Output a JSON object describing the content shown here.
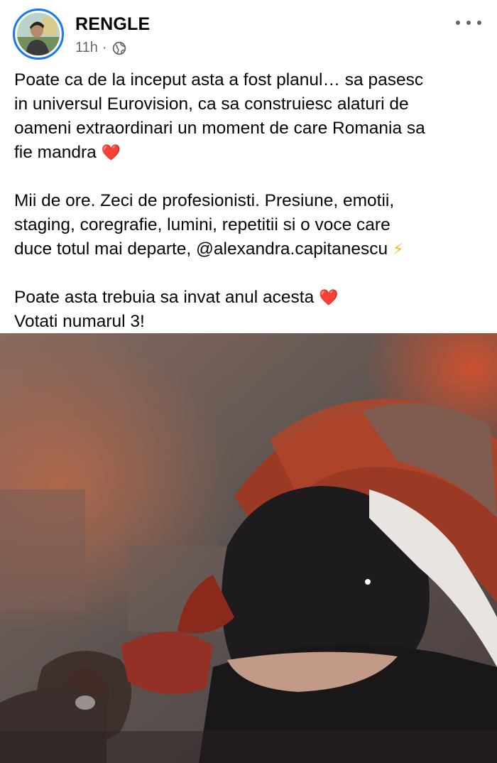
{
  "post": {
    "author": "RENGLE",
    "time": "11h",
    "separator": "·",
    "privacy_icon": "globe-icon",
    "more_icon": "more-options-icon",
    "paragraphs": [
      {
        "lines": [
          "Poate ca de la inceput asta a fost planul… sa pasesc",
          "in universul Eurovision, ca sa construiesc alaturi de",
          "oameni extraordinari un moment de care Romania sa"
        ],
        "last_line": "fie mandra",
        "emoji": "❤️"
      },
      {
        "lines": [
          "Mii de ore. Zeci de profesionisti. Presiune, emotii,",
          "staging, coregrafie, lumini, repetitii si o voce care"
        ],
        "last_line": "duce totul mai departe, @alexandra.capitanescu",
        "emoji": "⚡"
      },
      {
        "line1": "Poate asta trebuia sa invat anul acesta",
        "emoji": "❤️",
        "line2": "Votati numarul 3!"
      }
    ]
  },
  "colors": {
    "avatar_ring": "#1877f2",
    "meta_text": "#65676b",
    "heart": "#e0112b",
    "bolt": "#f7b928"
  }
}
